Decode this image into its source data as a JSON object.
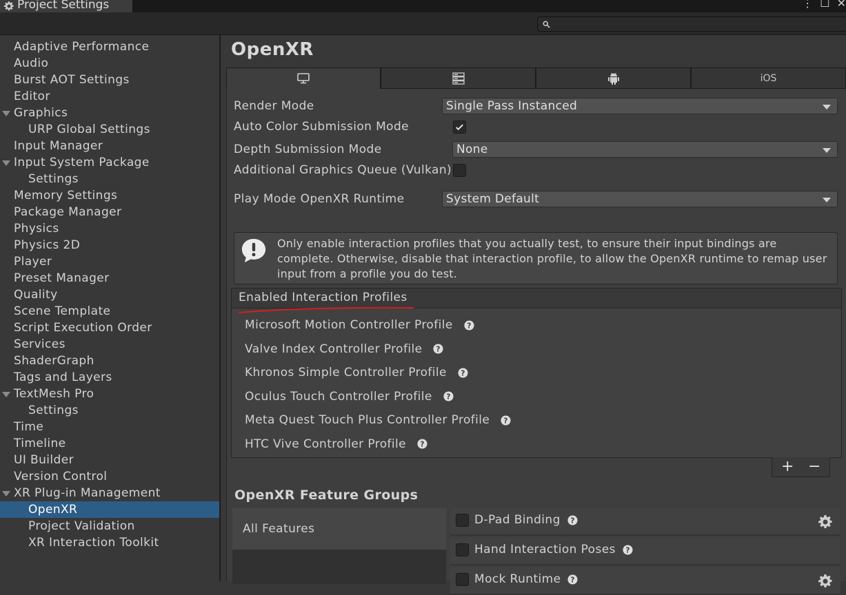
{
  "window": {
    "tab_title": "Project Settings",
    "controls": [
      "⋮",
      "☐",
      "✕"
    ]
  },
  "search": {
    "placeholder": "",
    "value": ""
  },
  "sidebar": {
    "items": [
      {
        "label": "Adaptive Performance",
        "level": 0
      },
      {
        "label": "Audio",
        "level": 0
      },
      {
        "label": "Burst AOT Settings",
        "level": 0
      },
      {
        "label": "Editor",
        "level": 0
      },
      {
        "label": "Graphics",
        "level": 0,
        "expanded": true
      },
      {
        "label": "URP Global Settings",
        "level": 1
      },
      {
        "label": "Input Manager",
        "level": 0
      },
      {
        "label": "Input System Package",
        "level": 0,
        "expanded": true
      },
      {
        "label": "Settings",
        "level": 1
      },
      {
        "label": "Memory Settings",
        "level": 0
      },
      {
        "label": "Package Manager",
        "level": 0
      },
      {
        "label": "Physics",
        "level": 0
      },
      {
        "label": "Physics 2D",
        "level": 0
      },
      {
        "label": "Player",
        "level": 0
      },
      {
        "label": "Preset Manager",
        "level": 0
      },
      {
        "label": "Quality",
        "level": 0
      },
      {
        "label": "Scene Template",
        "level": 0
      },
      {
        "label": "Script Execution Order",
        "level": 0
      },
      {
        "label": "Services",
        "level": 0
      },
      {
        "label": "ShaderGraph",
        "level": 0
      },
      {
        "label": "Tags and Layers",
        "level": 0
      },
      {
        "label": "TextMesh Pro",
        "level": 0,
        "expanded": true
      },
      {
        "label": "Settings",
        "level": 1
      },
      {
        "label": "Time",
        "level": 0
      },
      {
        "label": "Timeline",
        "level": 0
      },
      {
        "label": "UI Builder",
        "level": 0
      },
      {
        "label": "Version Control",
        "level": 0
      },
      {
        "label": "XR Plug-in Management",
        "level": 0,
        "expanded": true
      },
      {
        "label": "OpenXR",
        "level": 1,
        "selected": true
      },
      {
        "label": "Project Validation",
        "level": 1
      },
      {
        "label": "XR Interaction Toolkit",
        "level": 1
      }
    ]
  },
  "main": {
    "title": "OpenXR",
    "platform_tabs": [
      {
        "icon": "desktop-icon",
        "label": "",
        "active": true
      },
      {
        "icon": "server-icon",
        "label": "",
        "active": false
      },
      {
        "icon": "android-icon",
        "label": "",
        "active": false
      },
      {
        "icon": "",
        "label": "iOS",
        "active": false
      }
    ],
    "render_mode": {
      "label": "Render Mode",
      "value": "Single Pass Instanced"
    },
    "auto_color": {
      "label": "Auto Color Submission Mode",
      "checked": true
    },
    "depth_submission": {
      "label": "Depth Submission Mode",
      "value": "None"
    },
    "additional_queue": {
      "label": "Additional Graphics Queue (Vulkan)",
      "checked": false
    },
    "play_mode_runtime": {
      "label": "Play Mode OpenXR Runtime",
      "value": "System Default"
    },
    "help_text": "Only enable interaction profiles that you actually test, to ensure their input bindings are complete. Otherwise, disable that interaction profile, to allow the OpenXR runtime to remap user input from a profile you do test.",
    "profiles": {
      "header": "Enabled Interaction Profiles",
      "items": [
        "Microsoft Motion Controller Profile",
        "Valve Index Controller Profile",
        "Khronos Simple Controller Profile",
        "Oculus Touch Controller Profile",
        "Meta Quest Touch Plus Controller Profile",
        "HTC Vive Controller Profile"
      ],
      "add_label": "+",
      "remove_label": "−"
    },
    "feature_groups": {
      "title": "OpenXR Feature Groups",
      "groups": [
        "All Features"
      ],
      "features": [
        {
          "label": "D-Pad Binding",
          "checked": false,
          "has_settings": true
        },
        {
          "label": "Hand Interaction Poses",
          "checked": false,
          "has_settings": false
        },
        {
          "label": "Mock Runtime",
          "checked": false,
          "has_settings": true
        }
      ]
    }
  },
  "colors": {
    "selection": "#2c5d87",
    "annotation_underline": "#d42020"
  }
}
